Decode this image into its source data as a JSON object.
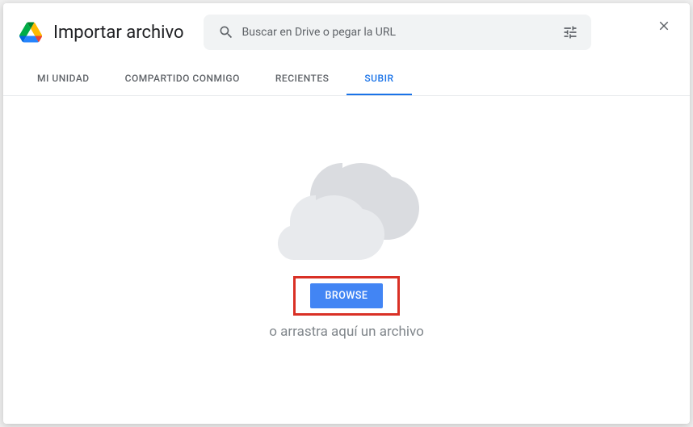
{
  "dialog": {
    "title": "Importar archivo"
  },
  "search": {
    "placeholder": "Buscar en Drive o pegar la URL"
  },
  "tabs": {
    "my_drive": "MI UNIDAD",
    "shared": "COMPARTIDO CONMIGO",
    "recent": "RECIENTES",
    "upload": "SUBIR"
  },
  "upload": {
    "browse_label": "BROWSE",
    "drag_text": "o arrastra aquí un archivo"
  }
}
